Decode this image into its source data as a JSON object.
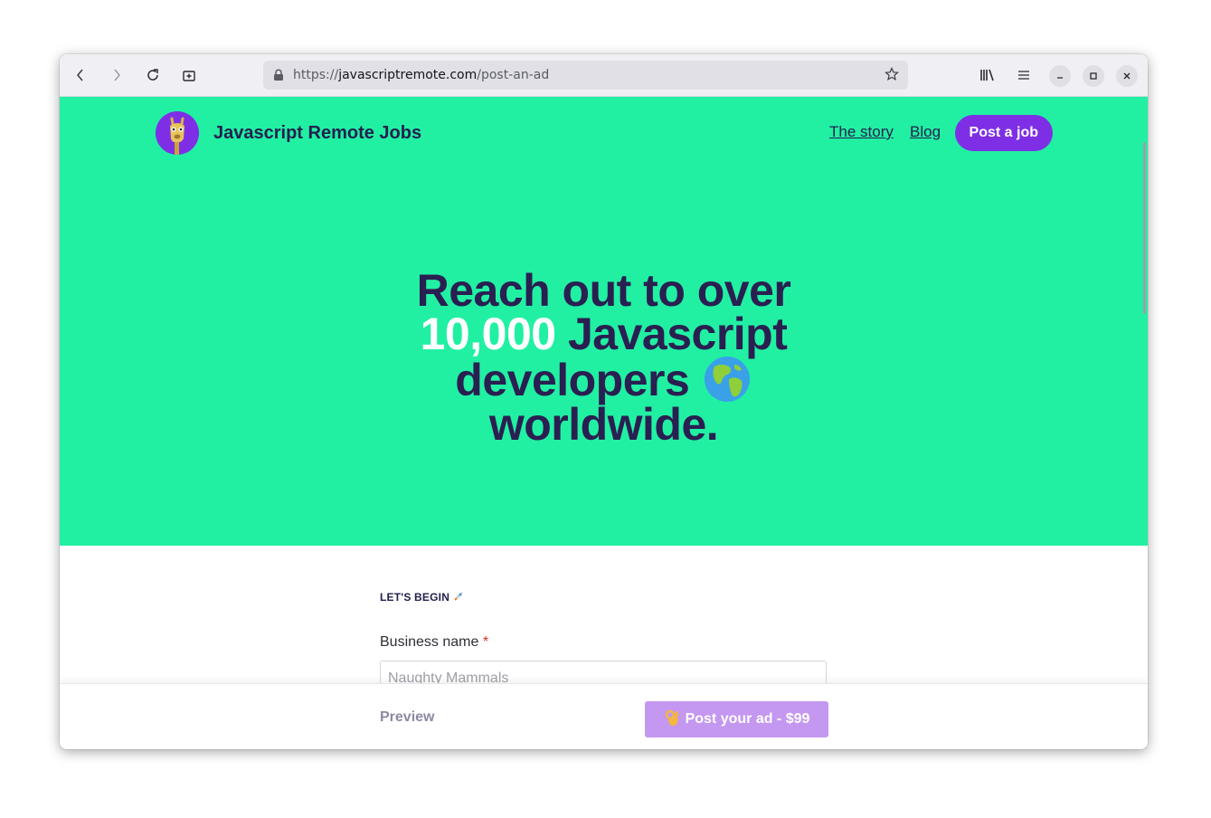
{
  "browser": {
    "url_scheme": "https://",
    "url_host": "javascriptremote.com",
    "url_path": "/post-an-ad"
  },
  "site": {
    "brand": "Javascript Remote Jobs",
    "nav": {
      "story": "The story",
      "blog": "Blog",
      "post_job": "Post a job"
    },
    "accent_color": "#7e2fe6",
    "hero_color": "#21f0a3"
  },
  "hero": {
    "line1": "Reach out to over",
    "highlight": "10,000",
    "line2_rest": "Javascript",
    "line3": "developers",
    "line4": "worldwide."
  },
  "form": {
    "section_label": "LET'S BEGIN",
    "business_name_label": "Business name",
    "required_mark": "*",
    "business_name_placeholder": "Naughty Mammals"
  },
  "footer": {
    "preview": "Preview",
    "post_ad": "Post your ad - $99"
  }
}
